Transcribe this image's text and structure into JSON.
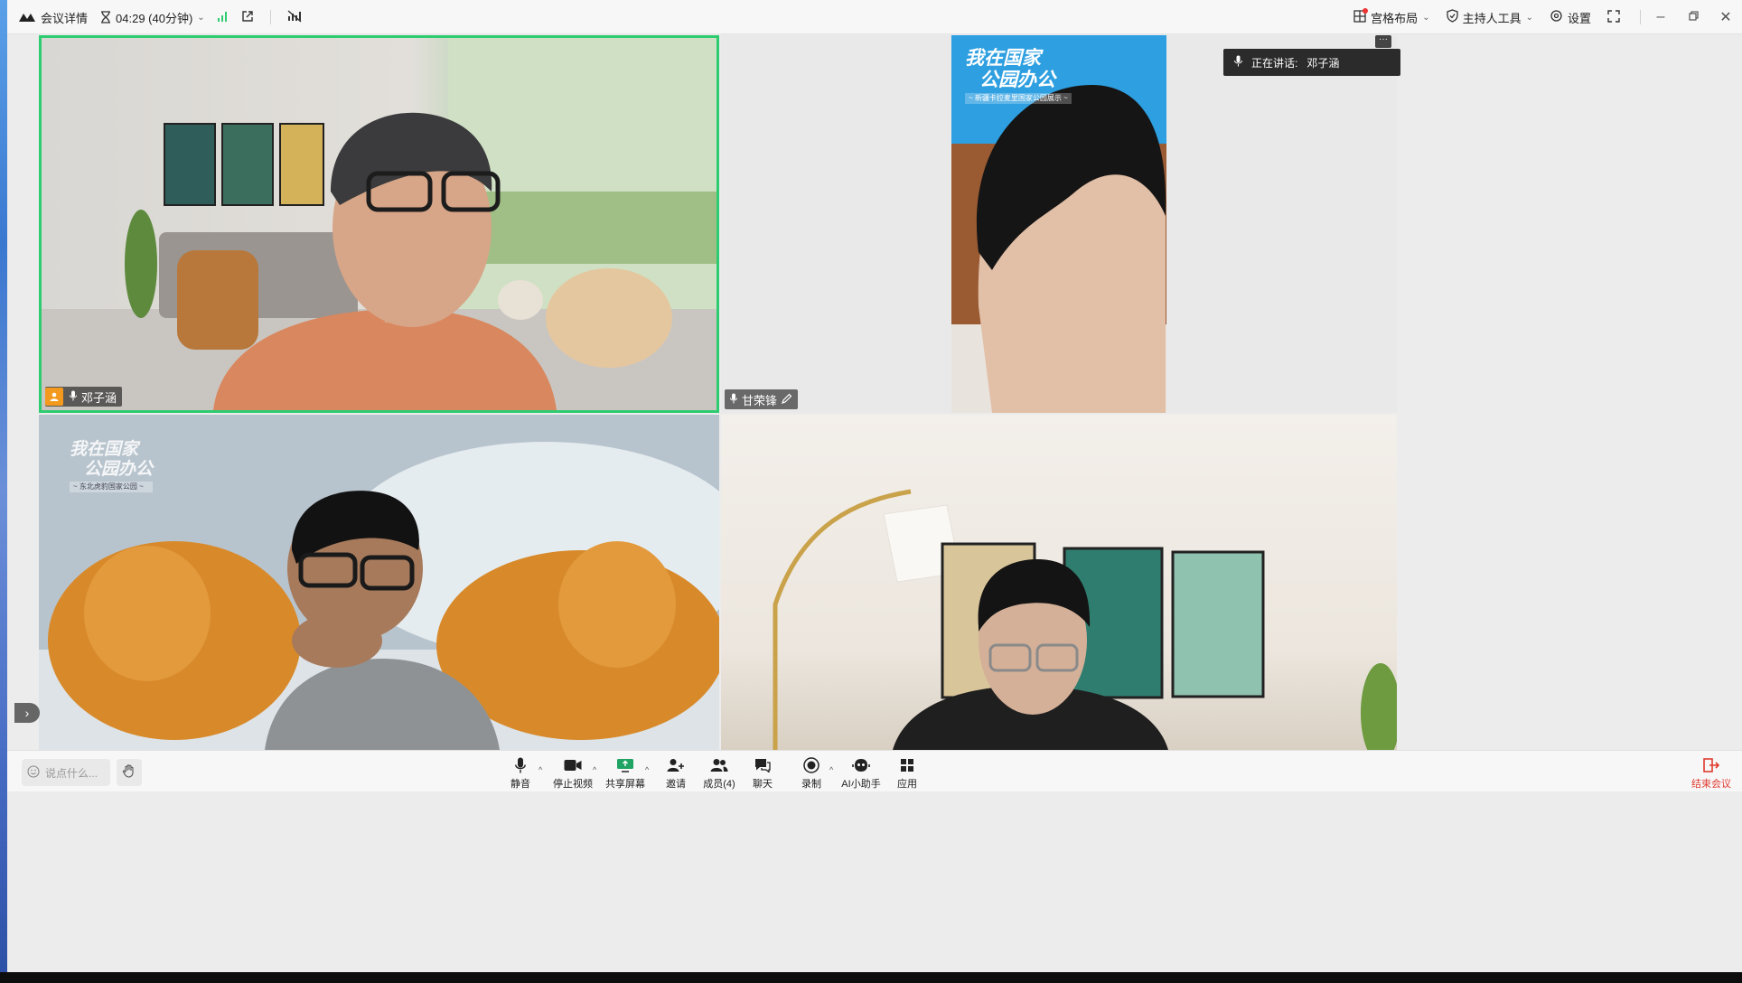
{
  "topbar": {
    "meeting_info": "会议详情",
    "timer": "04:29 (40分钟)",
    "layout_label": "宫格布局",
    "host_tools_label": "主持人工具",
    "settings_label": "设置"
  },
  "tiles": [
    {
      "name": "邓子涵",
      "is_host": true,
      "speaking": true
    },
    {
      "name": "甘荣锋",
      "is_host": false,
      "speaking": false
    },
    {
      "name": "",
      "is_host": false,
      "speaking": false
    },
    {
      "name": "",
      "is_host": false,
      "speaking": false
    }
  ],
  "tile2_banner": {
    "title_line1": "我在国家",
    "title_line2": "公园办公",
    "subtitle": "~ 新疆卡拉麦里国家公园展示 ~"
  },
  "tile3_banner": {
    "title_line1": "我在国家",
    "title_line2": "公园办公",
    "subtitle": "~ 东北虎豹国家公园 ~"
  },
  "speaking_indicator": {
    "label": "正在讲话:",
    "name": "邓子涵"
  },
  "toolbar": {
    "chat_placeholder": "说点什么...",
    "mute": "静音",
    "stop_video": "停止视频",
    "share_screen": "共享屏幕",
    "invite": "邀请",
    "members": "成员(4)",
    "chat": "聊天",
    "record": "录制",
    "ai_assistant": "AI小助手",
    "apps": "应用",
    "end_meeting": "结束会议"
  },
  "colors": {
    "active_speaker_border": "#2ecc71",
    "host_badge": "#f39a1e",
    "end_meeting": "#e03a2f",
    "signal": "#2ecc71"
  }
}
